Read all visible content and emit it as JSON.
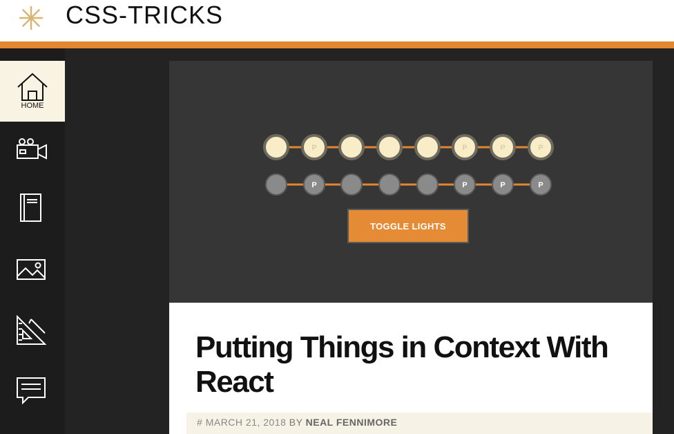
{
  "header": {
    "site_title": "CSS-TRICKS",
    "logo_icon": "asterisk-logo-icon"
  },
  "sidebar": {
    "items": [
      {
        "label": "HOME",
        "icon": "house-icon",
        "active": true
      },
      {
        "label": "",
        "icon": "video-camera-icon",
        "active": false
      },
      {
        "label": "",
        "icon": "notebook-icon",
        "active": false
      },
      {
        "label": "",
        "icon": "image-icon",
        "active": false
      },
      {
        "label": "",
        "icon": "ruler-triangle-icon",
        "active": false
      },
      {
        "label": "",
        "icon": "speech-bubble-icon",
        "active": false
      }
    ]
  },
  "hero": {
    "top_row": [
      "",
      "P",
      "",
      "",
      "",
      "P",
      "P",
      "P"
    ],
    "bottom_row": [
      "",
      "P",
      "",
      "",
      "",
      "P",
      "P",
      "P"
    ],
    "toggle_label": "TOGGLE LIGHTS"
  },
  "article": {
    "title": "Putting Things in Context With React",
    "meta_prefix": "#",
    "date": "MARCH 21, 2018",
    "by": "BY",
    "author": "NEAL FENNIMORE"
  },
  "colors": {
    "accent": "#e2872f",
    "light_on": "#f8edc6",
    "light_off": "#8a8a8a",
    "hero_bg": "#363636"
  }
}
